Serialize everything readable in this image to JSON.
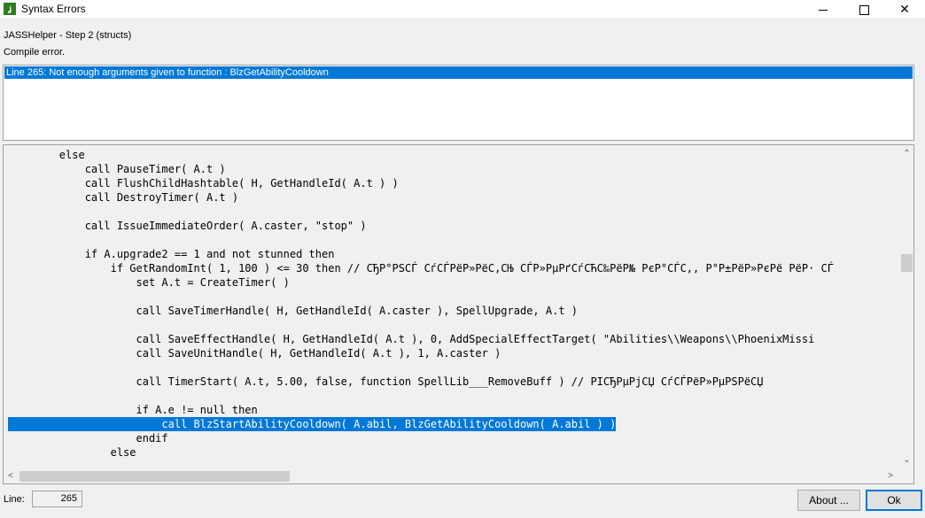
{
  "window": {
    "title": "Syntax Errors",
    "icon_name": "jasshelper-app-icon",
    "icon_glyph": "ʝ",
    "controls": {
      "minimize": "minimize-icon",
      "maximize": "maximize-icon",
      "close": "close-icon",
      "close_glyph": "✕"
    }
  },
  "header": {
    "step_label": "JASSHelper - Step 2 (structs)",
    "status_label": "Compile error."
  },
  "errors": {
    "items": [
      "Line 265: Not enough arguments given to function : BlzGetAbilityCooldown"
    ],
    "selected_index": 0
  },
  "code": {
    "lines": [
      {
        "text": "        else"
      },
      {
        "text": "            call PauseTimer( A.t )"
      },
      {
        "text": "            call FlushChildHashtable( H, GetHandleId( A.t ) )"
      },
      {
        "text": "            call DestroyTimer( A.t )"
      },
      {
        "text": ""
      },
      {
        "text": "            call IssueImmediateOrder( A.caster, \"stop\" )"
      },
      {
        "text": ""
      },
      {
        "text": "            if A.upgrade2 == 1 and not stunned then"
      },
      {
        "text": "                if GetRandomInt( 1, 100 ) <= 30 then // СЂР°РЅСЃ СѓСЃРёР»РёС‚СЊ СЃР»РµРґСѓСЋС‰РёР№ РєР°СЃС‚, Р°Р±РёР»РєРё РёР· СЃ"
      },
      {
        "text": "                    set A.t = CreateTimer( )"
      },
      {
        "text": ""
      },
      {
        "text": "                    call SaveTimerHandle( H, GetHandleId( A.caster ), SpellUpgrade, A.t )"
      },
      {
        "text": ""
      },
      {
        "text": "                    call SaveEffectHandle( H, GetHandleId( A.t ), 0, AddSpecialEffectTarget( \"Abilities\\\\Weapons\\\\PhoenixMissi"
      },
      {
        "text": "                    call SaveUnitHandle( H, GetHandleId( A.t ), 1, A.caster )"
      },
      {
        "text": ""
      },
      {
        "text": "                    call TimerStart( A.t, 5.00, false, function SpellLib___RemoveBuff ) // РІСЂРµРјСЏ СѓСЃРёР»РµРЅРёСЏ"
      },
      {
        "text": ""
      },
      {
        "text": "                    if A.e != null then"
      },
      {
        "text": "                        call BlzStartAbilityCooldown( A.abil, BlzGetAbilityCooldown( A.abil ) )"
      },
      {
        "text": "                    endif"
      },
      {
        "text": "                else"
      }
    ],
    "selected_line_index": 19,
    "vscroll_position": 0.36,
    "hscroll_position": 0.0
  },
  "footer": {
    "line_label": "Line:",
    "line_value": "265",
    "about_label": "About ...",
    "ok_label": "Ok"
  },
  "colors": {
    "selection": "#0078d7",
    "background": "#f0f0f0"
  }
}
